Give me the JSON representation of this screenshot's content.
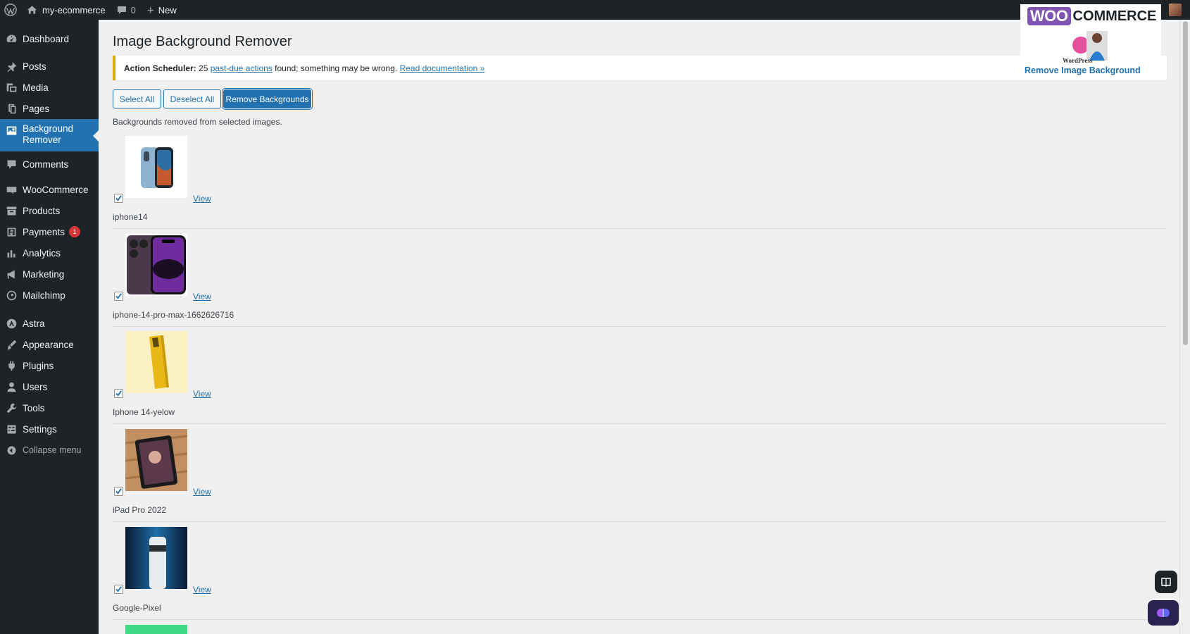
{
  "adminbar": {
    "site_name": "my-ecommerce",
    "comments_count": "0",
    "new_label": "New"
  },
  "sidebar": {
    "items": [
      {
        "label": "Dashboard",
        "icon": "dashboard-icon"
      },
      {
        "label": "Posts",
        "icon": "pin-icon"
      },
      {
        "label": "Media",
        "icon": "media-icon"
      },
      {
        "label": "Pages",
        "icon": "pages-icon"
      },
      {
        "label": "Background Remover",
        "icon": "image-icon",
        "current": true
      },
      {
        "label": "Comments",
        "icon": "comment-icon"
      },
      {
        "label": "WooCommerce",
        "icon": "woo-icon"
      },
      {
        "label": "Products",
        "icon": "archive-icon"
      },
      {
        "label": "Payments",
        "icon": "dollar-icon",
        "badge": "1"
      },
      {
        "label": "Analytics",
        "icon": "chart-icon"
      },
      {
        "label": "Marketing",
        "icon": "megaphone-icon"
      },
      {
        "label": "Mailchimp",
        "icon": "mailchimp-icon"
      },
      {
        "label": "Astra",
        "icon": "astra-icon"
      },
      {
        "label": "Appearance",
        "icon": "brush-icon"
      },
      {
        "label": "Plugins",
        "icon": "plugin-icon"
      },
      {
        "label": "Users",
        "icon": "user-icon"
      },
      {
        "label": "Tools",
        "icon": "wrench-icon"
      },
      {
        "label": "Settings",
        "icon": "settings-icon"
      }
    ],
    "collapse_label": "Collapse menu"
  },
  "page": {
    "title": "Image Background Remover",
    "notice": {
      "strong": "Action Scheduler:",
      "count_text": "25",
      "link1": "past-due actions",
      "middle": "found; something may be wrong.",
      "link2": "Read documentation »"
    },
    "buttons": {
      "select_all": "Select All",
      "deselect_all": "Deselect All",
      "remove": "Remove Backgrounds"
    },
    "status": "Backgrounds removed from selected images.",
    "view_label": "View",
    "images": [
      {
        "name": "iphone14",
        "checked": true
      },
      {
        "name": "iphone-14-pro-max-1662626716",
        "checked": true
      },
      {
        "name": "Iphone 14-yelow",
        "checked": true
      },
      {
        "name": "iPad Pro 2022",
        "checked": true
      },
      {
        "name": "Google-Pixel",
        "checked": true
      }
    ]
  },
  "promo": {
    "woo": "WOO",
    "commerce": "COMMERCE",
    "wordpress": "WordPress",
    "title": "Remove Image Background"
  },
  "colors": {
    "accent": "#2271b1",
    "sidebar_bg": "#1d2327",
    "content_bg": "#f0f0f1",
    "notice_warning": "#dba617",
    "badge_red": "#d63638"
  }
}
